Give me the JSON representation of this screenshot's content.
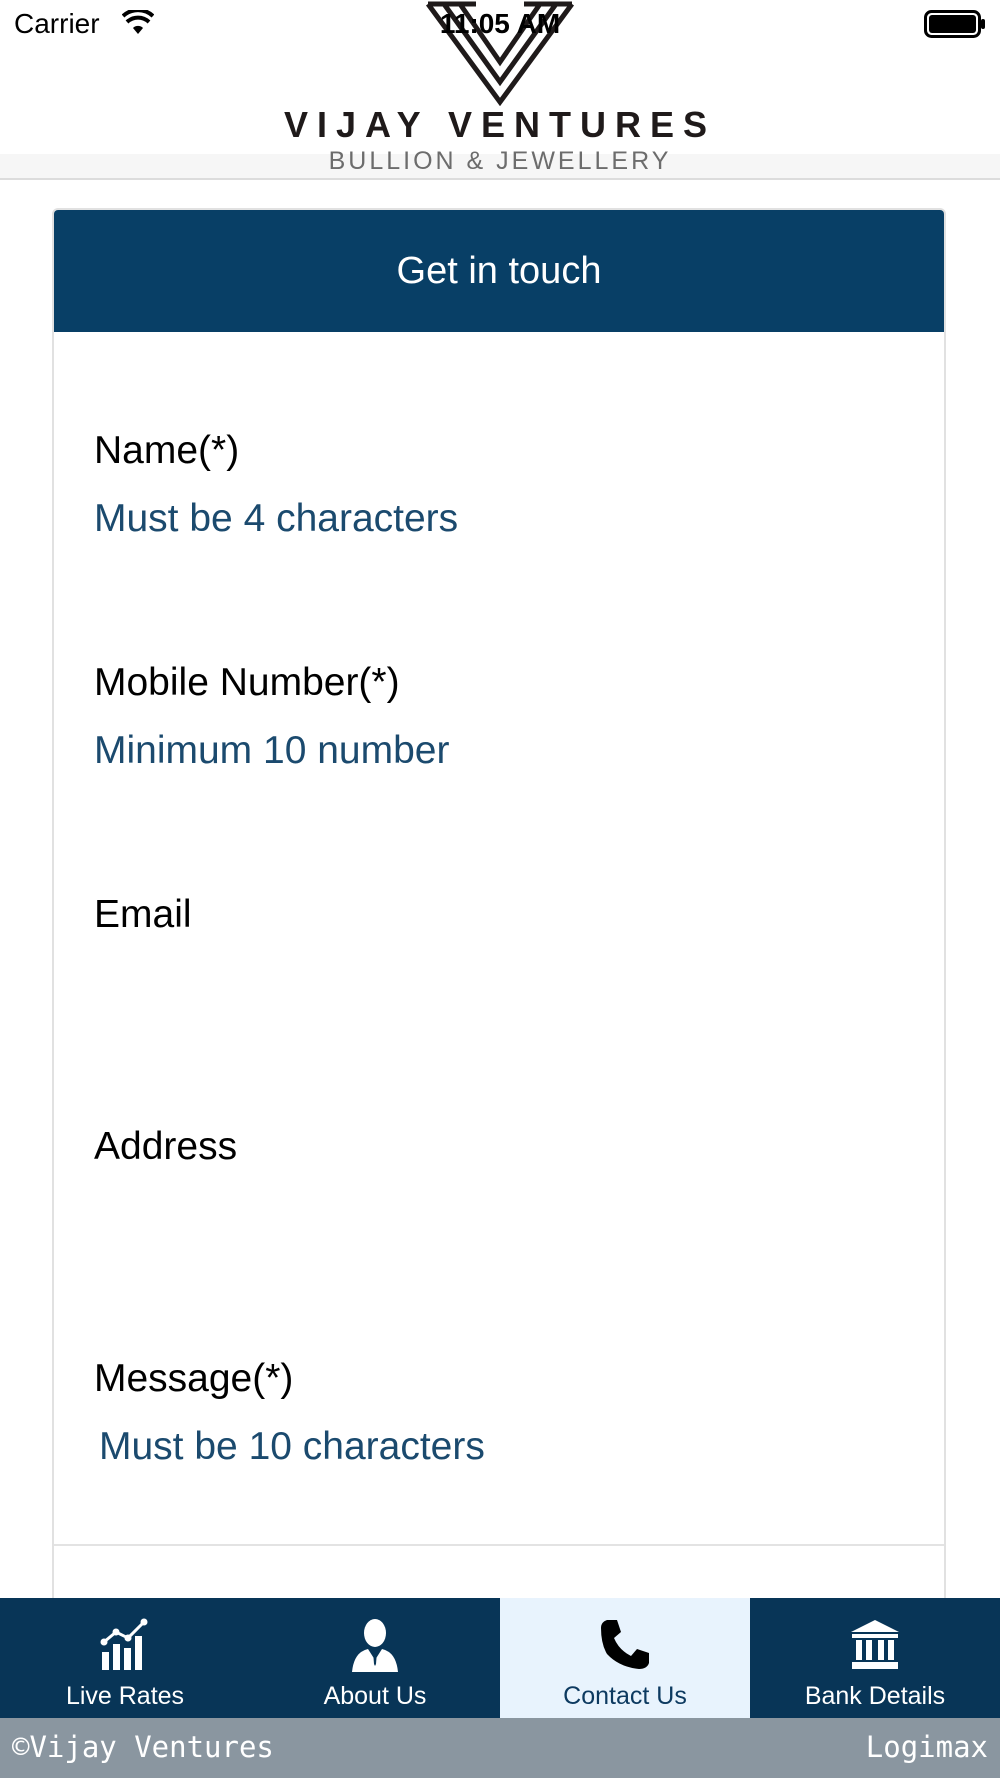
{
  "status_bar": {
    "carrier": "Carrier",
    "time": "11:05 AM"
  },
  "header": {
    "brand_name": "VIJAY VENTURES",
    "brand_tagline": "BULLION & JEWELLERY"
  },
  "form": {
    "title": "Get in touch",
    "fields": [
      {
        "label": "Name(*)",
        "hint": "Must be 4 characters"
      },
      {
        "label": "Mobile Number(*)",
        "hint": "Minimum 10 number"
      },
      {
        "label": "Email",
        "hint": ""
      },
      {
        "label": "Address",
        "hint": ""
      },
      {
        "label": "Message(*)",
        "hint": "Must be 10 characters"
      }
    ]
  },
  "tabs": [
    {
      "label": "Live Rates",
      "icon": "chart-icon",
      "active": false
    },
    {
      "label": "About Us",
      "icon": "person-icon",
      "active": false
    },
    {
      "label": "Contact Us",
      "icon": "phone-icon",
      "active": true
    },
    {
      "label": "Bank Details",
      "icon": "bank-icon",
      "active": false
    }
  ],
  "footer": {
    "left": "©Vijay Ventures",
    "right": "Logimax"
  },
  "colors": {
    "primary": "#083f66",
    "tab_bar": "#083557",
    "active_tab": "#e8f3fd",
    "hint_text": "#1b4a6e",
    "footer": "#8a96a0"
  }
}
